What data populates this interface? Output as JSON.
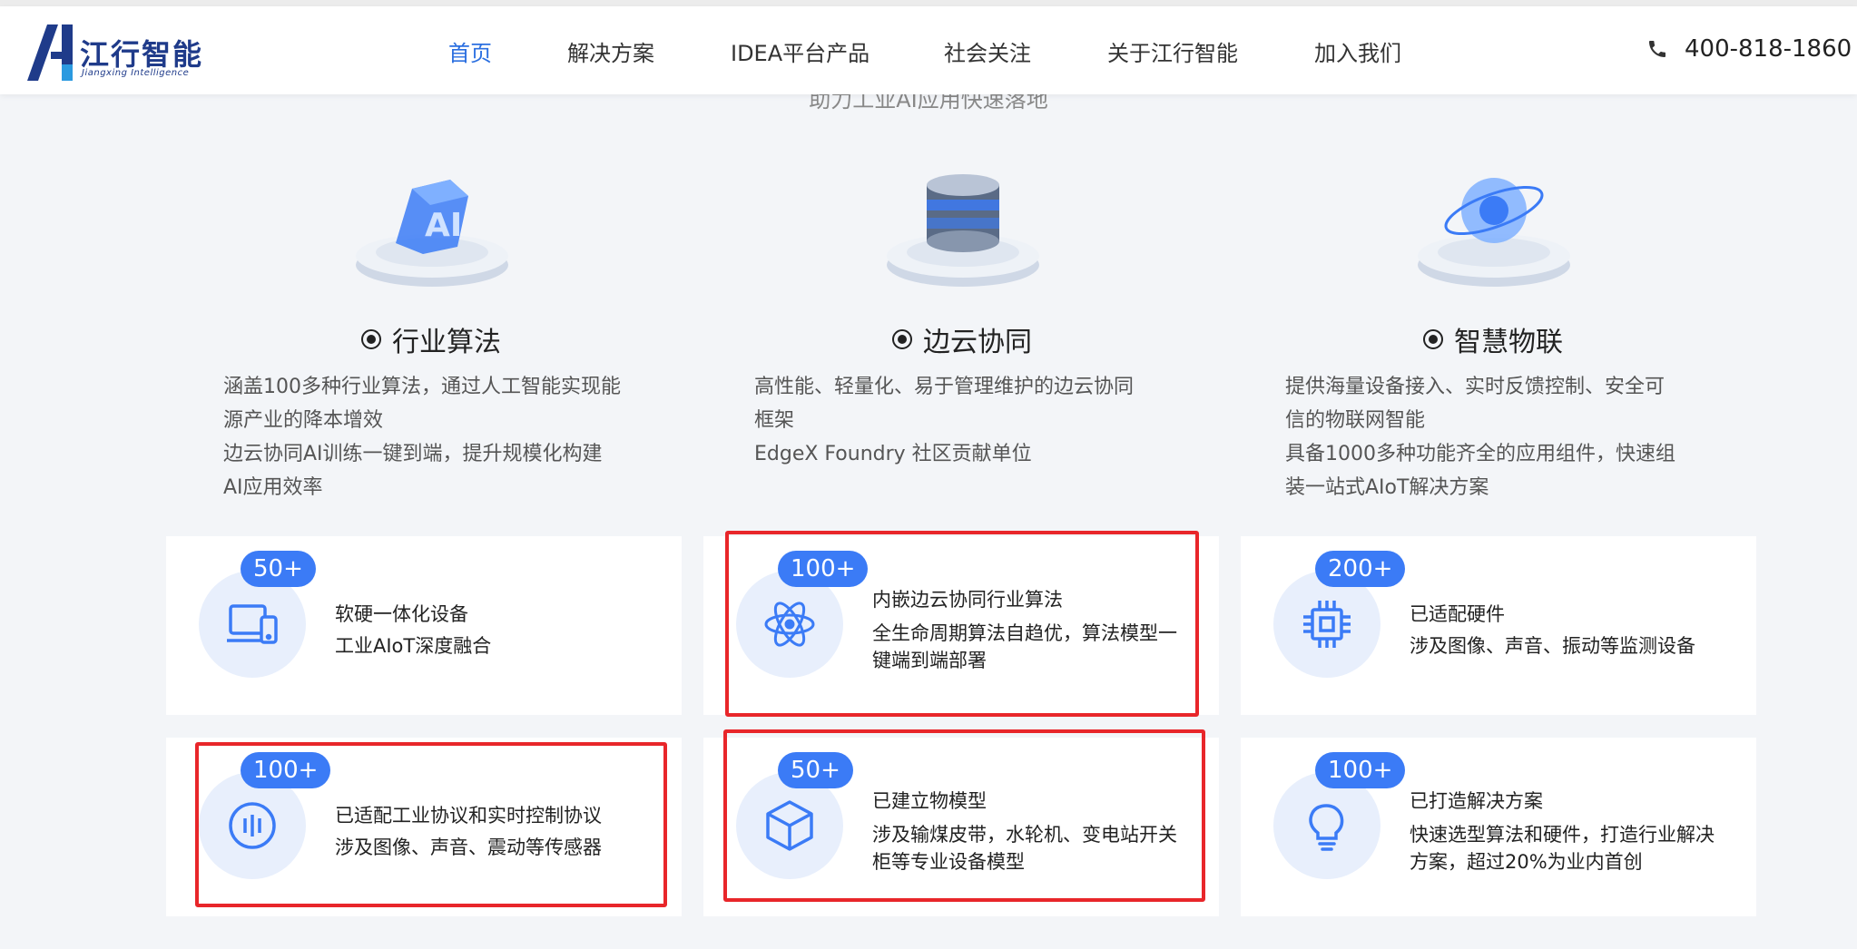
{
  "header": {
    "logo_name": "江行智能",
    "logo_sub": "Jiangxing Intelligence",
    "nav": [
      {
        "label": "首页",
        "active": true
      },
      {
        "label": "解决方案",
        "active": false
      },
      {
        "label": "IDEA平台产品",
        "active": false
      },
      {
        "label": "社会关注",
        "active": false
      },
      {
        "label": "关于江行智能",
        "active": false
      },
      {
        "label": "加入我们",
        "active": false
      }
    ],
    "phone": "400-818-1860"
  },
  "tagline": "助力工业AI应用快速落地",
  "features": [
    {
      "title": "行业算法",
      "image": "ai-cube-icon",
      "lines": [
        "涵盖100多种行业算法，通过人工智能实现能",
        "源产业的降本增效",
        "边云协同AI训练一键到端，提升规模化构建",
        "AI应用效率"
      ]
    },
    {
      "title": "边云协同",
      "image": "database-server-icon",
      "lines": [
        "高性能、轻量化、易于管理维护的边云协同",
        "框架",
        "EdgeX Foundry 社区贡献单位"
      ]
    },
    {
      "title": "智慧物联",
      "image": "globe-orbit-icon",
      "lines": [
        "提供海量设备接入、实时反馈控制、安全可",
        "信的物联网智能",
        "具备1000多种功能齐全的应用组件，快速组",
        "装一站式AIoT解决方案"
      ]
    }
  ],
  "cards": [
    {
      "badge": "50+",
      "icon": "laptop-phone-icon",
      "title": "软硬一体化设备",
      "desc": [
        "工业AIoT深度融合"
      ]
    },
    {
      "badge": "100+",
      "icon": "atom-icon",
      "title": "内嵌边云协同行业算法",
      "desc": [
        "全生命周期算法自趋优，算法模型一",
        "键端到端部署"
      ]
    },
    {
      "badge": "200+",
      "icon": "chip-icon",
      "title": "已适配硬件",
      "desc": [
        "涉及图像、声音、振动等监测设备"
      ]
    },
    {
      "badge": "100+",
      "icon": "signal-bars-icon",
      "title": "已适配工业协议和实时控制协议",
      "desc": [
        "涉及图像、声音、震动等传感器"
      ]
    },
    {
      "badge": "50+",
      "icon": "cube-icon",
      "title": "已建立物模型",
      "desc": [
        "涉及输煤皮带，水轮机、变电站开关",
        "柜等专业设备模型"
      ]
    },
    {
      "badge": "100+",
      "icon": "lightbulb-icon",
      "title": "已打造解决方案",
      "desc": [
        "快速选型算法和硬件，打造行业解决",
        "方案，超过20%为业内首创"
      ]
    }
  ],
  "colors": {
    "accent": "#2b6fe0",
    "badge": "#3b7bf6",
    "highlight": "#e8262a"
  }
}
